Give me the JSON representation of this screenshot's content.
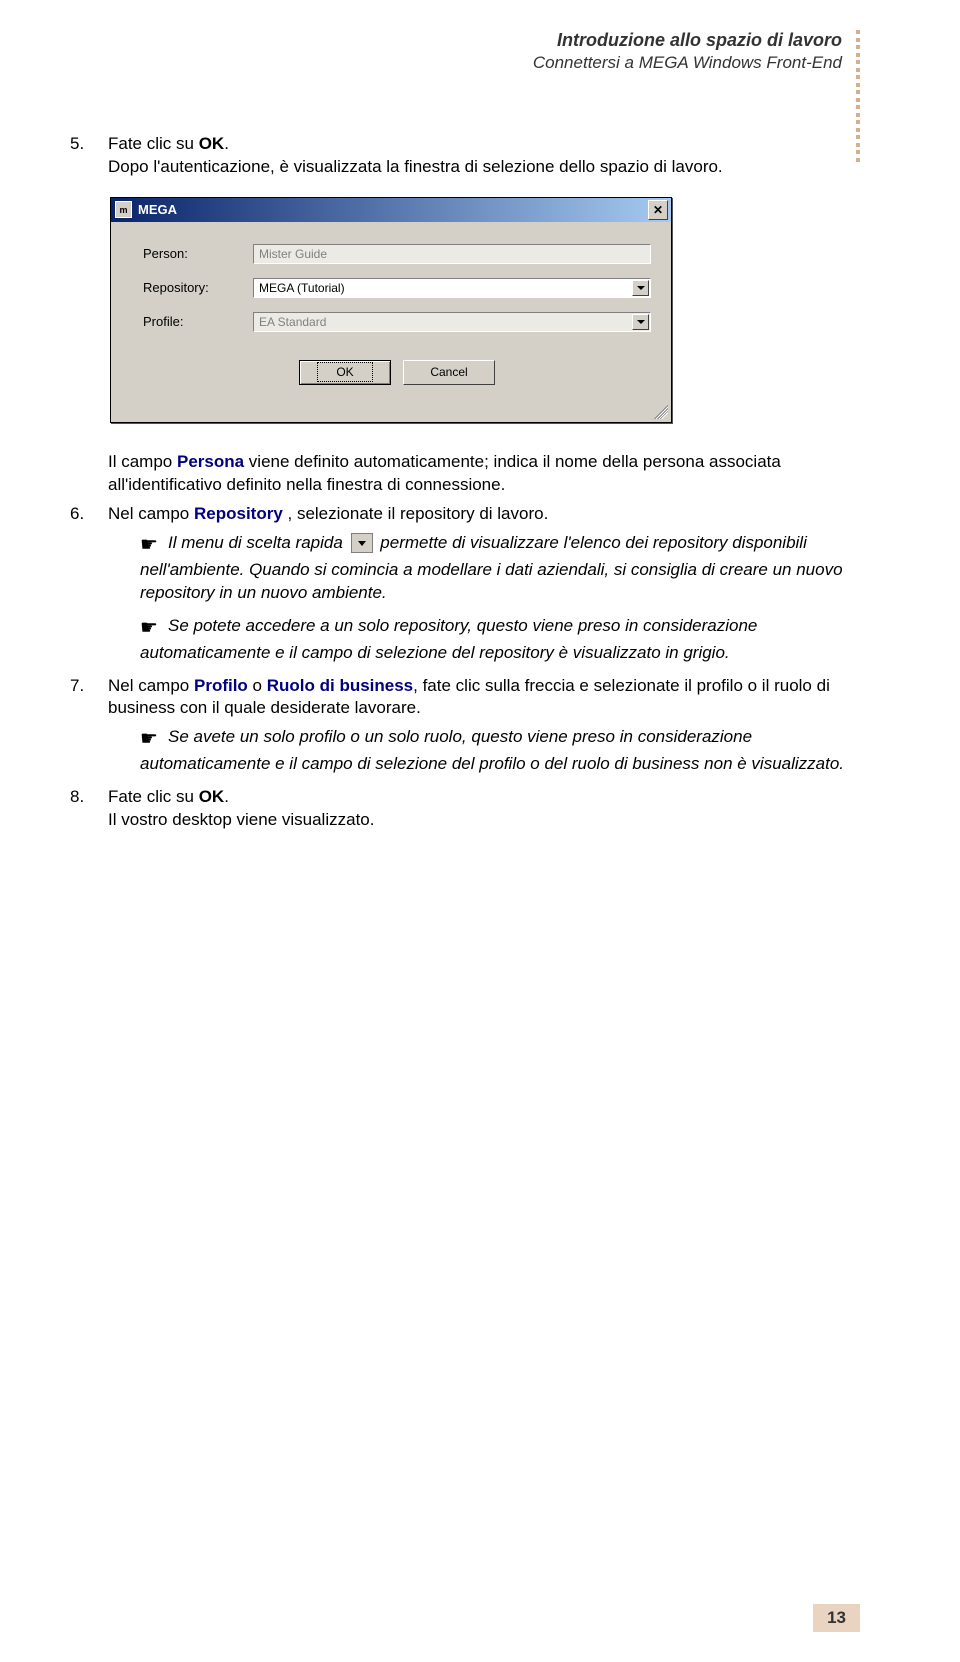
{
  "header": {
    "title": "Introduzione allo spazio di lavoro",
    "subtitle": "Connettersi a MEGA Windows Front-End"
  },
  "step5": {
    "num": "5.",
    "text_a": "Fate clic su ",
    "ok": "OK",
    "text_b": ".",
    "line2": "Dopo l'autenticazione, è visualizzata la finestra di selezione dello spazio di lavoro."
  },
  "dialog": {
    "icon": "m",
    "title": "MEGA",
    "labels": {
      "person": "Person:",
      "repository": "Repository:",
      "profile": "Profile:"
    },
    "values": {
      "person": "Mister Guide",
      "repository": "MEGA (Tutorial)",
      "profile": "EA Standard"
    },
    "buttons": {
      "ok": "OK",
      "cancel": "Cancel"
    }
  },
  "after_dialog": {
    "a": "Il campo ",
    "persona": "Persona",
    "b": " viene definito automaticamente; indica il nome della persona associata all'identificativo definito nella finestra di connessione."
  },
  "step6": {
    "num": "6.",
    "a": "Nel campo ",
    "repository": "Repository",
    "b": " , selezionate il repository di lavoro."
  },
  "note6a": "Il menu di scelta rapida",
  "note6a_end": "permette di visualizzare l'elenco dei repository disponibili nell'ambiente. Quando si comincia a modellare i dati aziendali, si consiglia di creare un nuovo repository in un nuovo ambiente.",
  "note6b": "Se potete accedere a un solo repository, questo viene preso in considerazione automaticamente e il campo di selezione del repository è visualizzato in grigio.",
  "step7": {
    "num": "7.",
    "a": "Nel campo ",
    "profilo": "Profilo",
    "or": " o ",
    "ruolo": "Ruolo di business",
    "b": ", fate clic sulla freccia e selezionate il profilo o il ruolo di business con il quale desiderate lavorare."
  },
  "note7": "Se avete un solo profilo o un solo ruolo, questo viene preso in considerazione automaticamente e il campo di selezione del profilo o del ruolo di business non è visualizzato.",
  "step8": {
    "num": "8.",
    "a": "Fate clic su ",
    "ok": "OK",
    "b": ".",
    "line2": "Il vostro desktop viene visualizzato."
  },
  "page_number": "13"
}
